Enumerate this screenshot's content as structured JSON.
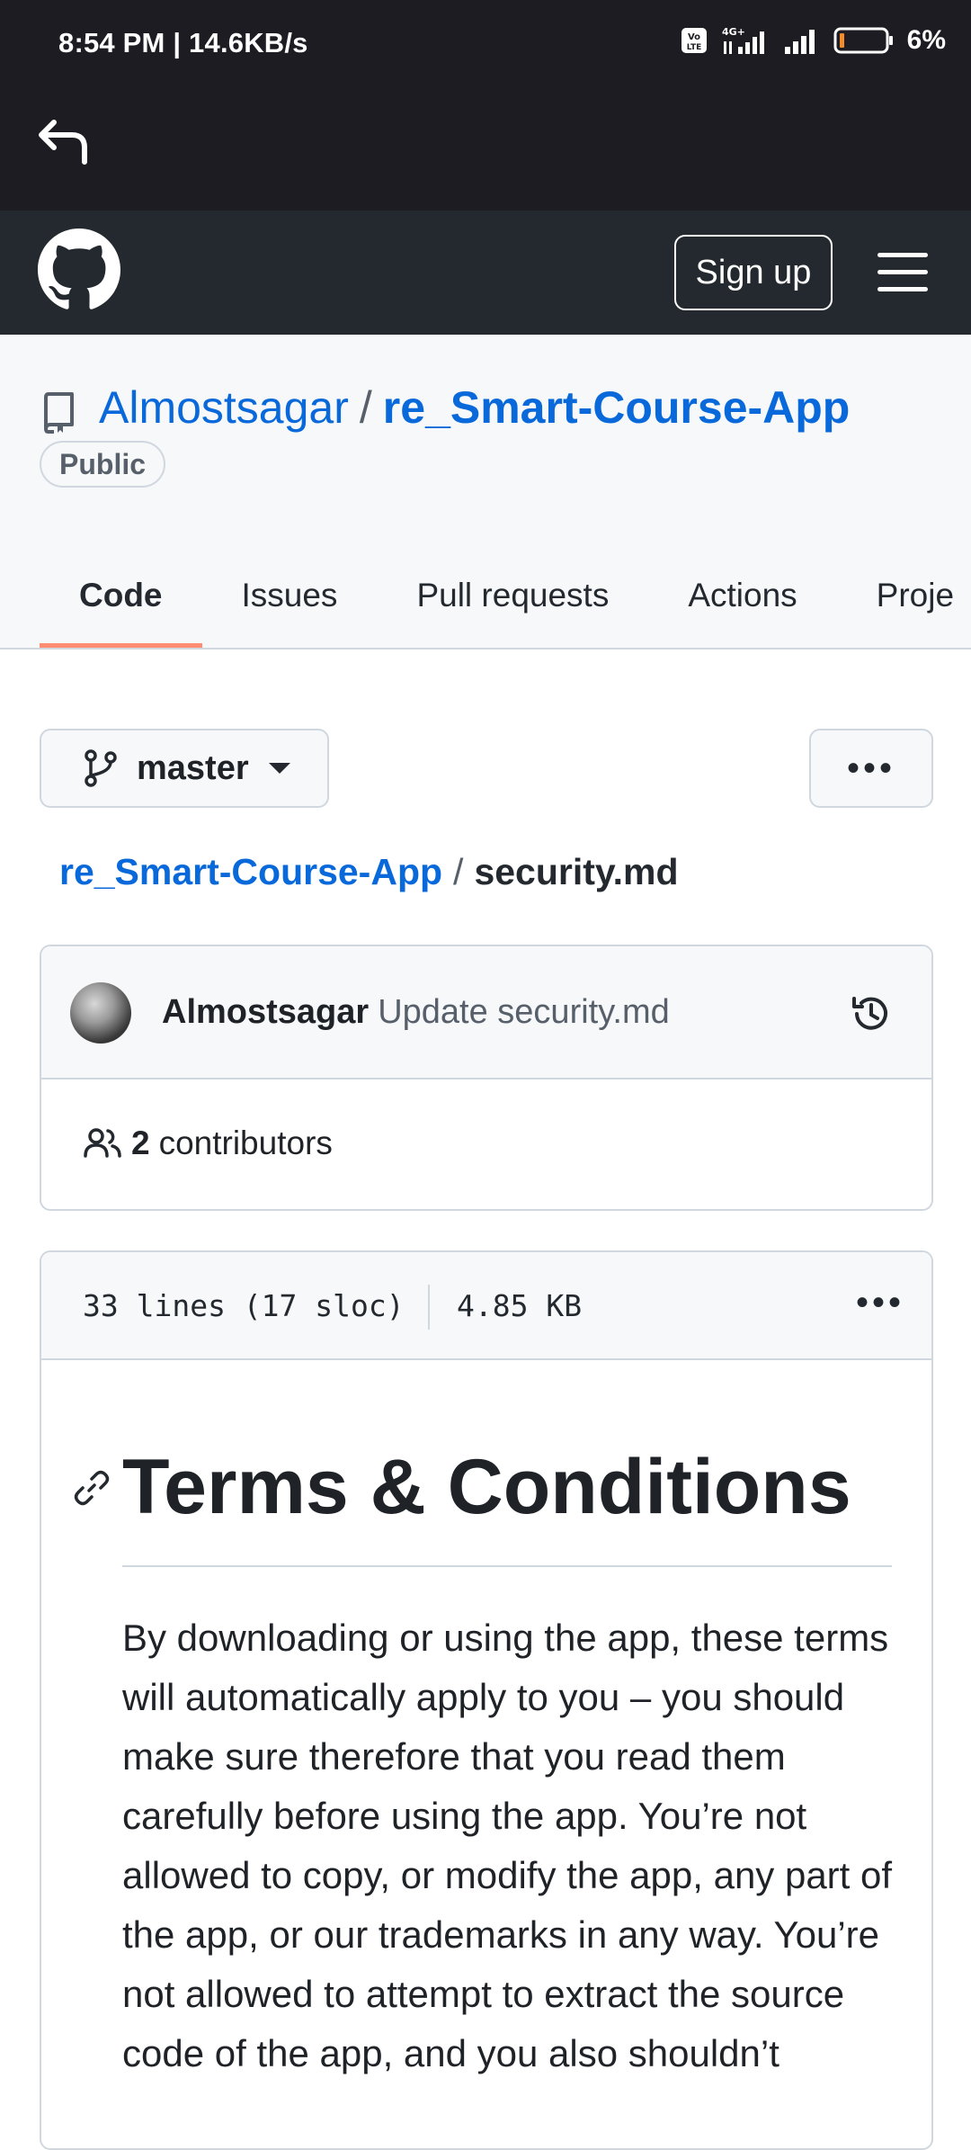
{
  "status_bar": {
    "time_speed": "8:54 PM | 14.6KB/s",
    "network": "4G+",
    "volte": "Vo LTE",
    "battery": "6%"
  },
  "app_bar": {
    "back_icon": "back-arrow-icon"
  },
  "github_header": {
    "sign_up": "Sign up"
  },
  "repo": {
    "owner": "Almostsagar",
    "separator": "/",
    "name": "re_Smart-Course-App",
    "visibility": "Public",
    "tabs": [
      "Code",
      "Issues",
      "Pull requests",
      "Actions",
      "Proje"
    ]
  },
  "branch": {
    "name": "master"
  },
  "breadcrumb": {
    "repo": "re_Smart-Course-App",
    "separator": "/",
    "file": "security.md"
  },
  "commit": {
    "author": "Almostsagar",
    "message": "Update security.md",
    "contributors_count": "2",
    "contributors_label": "contributors"
  },
  "file": {
    "lines": "33 lines (17 sloc)",
    "size": "4.85 KB",
    "heading": "Terms & Conditions",
    "paragraph": "By downloading or using the app, these terms will automatically apply to you – you should make sure therefore that you read them carefully before using the app. You’re not allowed to copy, or modify the app, any part of the app, or our trademarks in any way. You’re not allowed to attempt to extract the source code of the app, and you also shouldn’t"
  },
  "colors": {
    "link": "#0969da",
    "header_bg": "#24292f",
    "tab_underline": "#fd8c73"
  }
}
